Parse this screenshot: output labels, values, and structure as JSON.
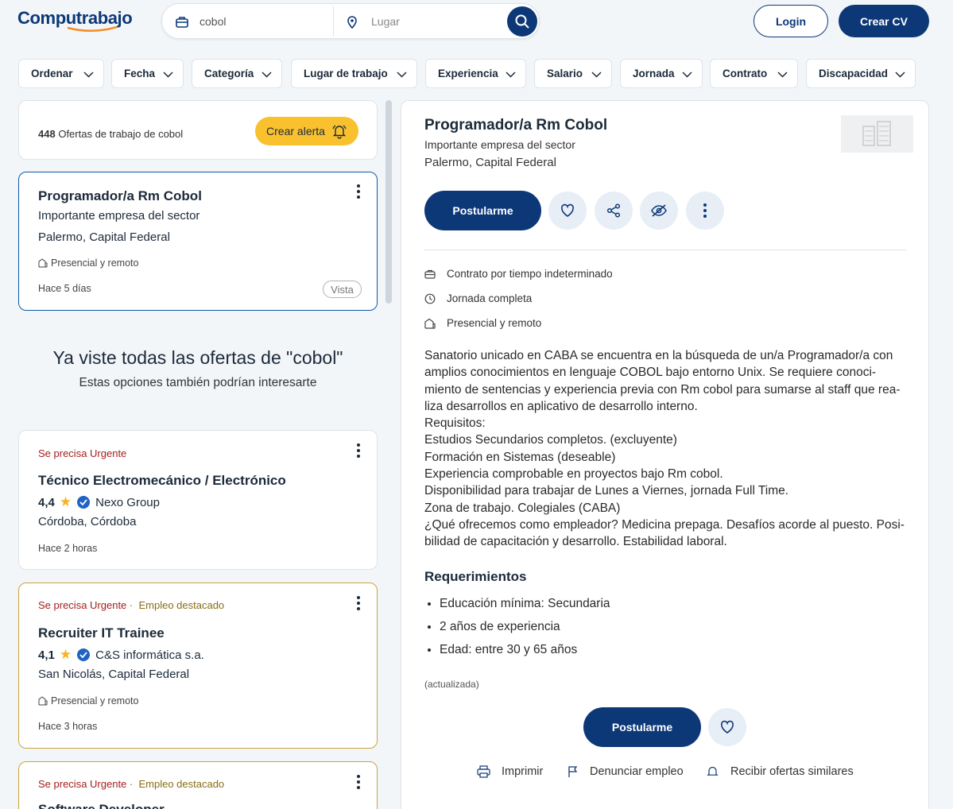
{
  "header": {
    "logo": "Computrabajo",
    "search_value": "cobol",
    "location_placeholder": "Lugar",
    "login_label": "Login",
    "create_cv_label": "Crear CV"
  },
  "filters": [
    "Ordenar",
    "Fecha",
    "Categoría",
    "Lugar de trabajo",
    "Experiencia",
    "Salario",
    "Jornada",
    "Contrato",
    "Discapacidad"
  ],
  "results": {
    "count": "448",
    "label": "Ofertas de trabajo de cobol",
    "alert_label": "Crear alerta"
  },
  "active_job": {
    "title": "Programador/a Rm Cobol",
    "company": "Importante empresa del sector",
    "location": "Palermo, Capital Federal",
    "modality": "Presencial y remoto",
    "posted": "Hace 5 días",
    "badge": "Vista"
  },
  "seen_all": {
    "title": "Ya viste todas las ofertas de \"cobol\"",
    "subtitle": "Estas opciones también podrían interesarte"
  },
  "suggested": [
    {
      "urgent": "Se precisa Urgente",
      "title": "Técnico Electromecánico / Electrónico",
      "rating": "4,4",
      "company": "Nexo Group",
      "location": "Córdoba, Córdoba",
      "posted": "Hace 2 horas"
    },
    {
      "urgent": "Se precisa Urgente",
      "featured": "Empleo destacado",
      "title": "Recruiter IT Trainee",
      "rating": "4,1",
      "company": "C&S informática s.a.",
      "location": "San Nicolás, Capital Federal",
      "modality": "Presencial y remoto",
      "posted": "Hace 3 horas"
    },
    {
      "urgent": "Se precisa Urgente",
      "featured": "Empleo destacado",
      "title": "Software Developer"
    }
  ],
  "detail": {
    "title": "Programador/a Rm Cobol",
    "company": "Importante empresa del sector",
    "location": "Palermo, Capital Federal",
    "apply_label": "Postularme",
    "contract": "Contrato por tiempo indeterminado",
    "schedule": "Jornada completa",
    "modality": "Presencial y remoto",
    "description": [
      "Sanatorio unicado en CABA se encuentra en la búsqueda de un/a Programador/a con",
      "amplios conocimientos en lenguaje COBOL bajo entorno Unix. Se requiere conoci-",
      "miento de sentencias y experiencia previa con Rm cobol para sumarse al staff que rea-",
      "liza desarrollos en aplicativo de desarrollo interno.",
      "Requisitos:",
      "Estudios Secundarios completos. (excluyente)",
      "Formación en Sistemas (deseable)",
      "Experiencia comprobable en proyectos bajo Rm cobol.",
      "Disponibilidad para trabajar de Lunes a Viernes, jornada Full Time.",
      "Zona de trabajo. Colegiales (CABA)",
      "¿Qué ofrecemos como empleador? Medicina prepaga. Desafíos acorde al puesto. Posi-",
      "bilidad de capacitación y desarrollo. Estabilidad laboral."
    ],
    "requirements_title": "Requerimientos",
    "requirements": [
      "Educación mínima: Secundaria",
      "2 años de experiencia",
      "Edad: entre 30 y 65 años"
    ],
    "updated": "(actualizada)",
    "print_label": "Imprimir",
    "report_label": "Denunciar empleo",
    "similar_label": "Recibir ofertas similares"
  },
  "colors": {
    "brand": "#0d3878",
    "accent": "#f9c12e",
    "urgent": "#a3201d"
  }
}
